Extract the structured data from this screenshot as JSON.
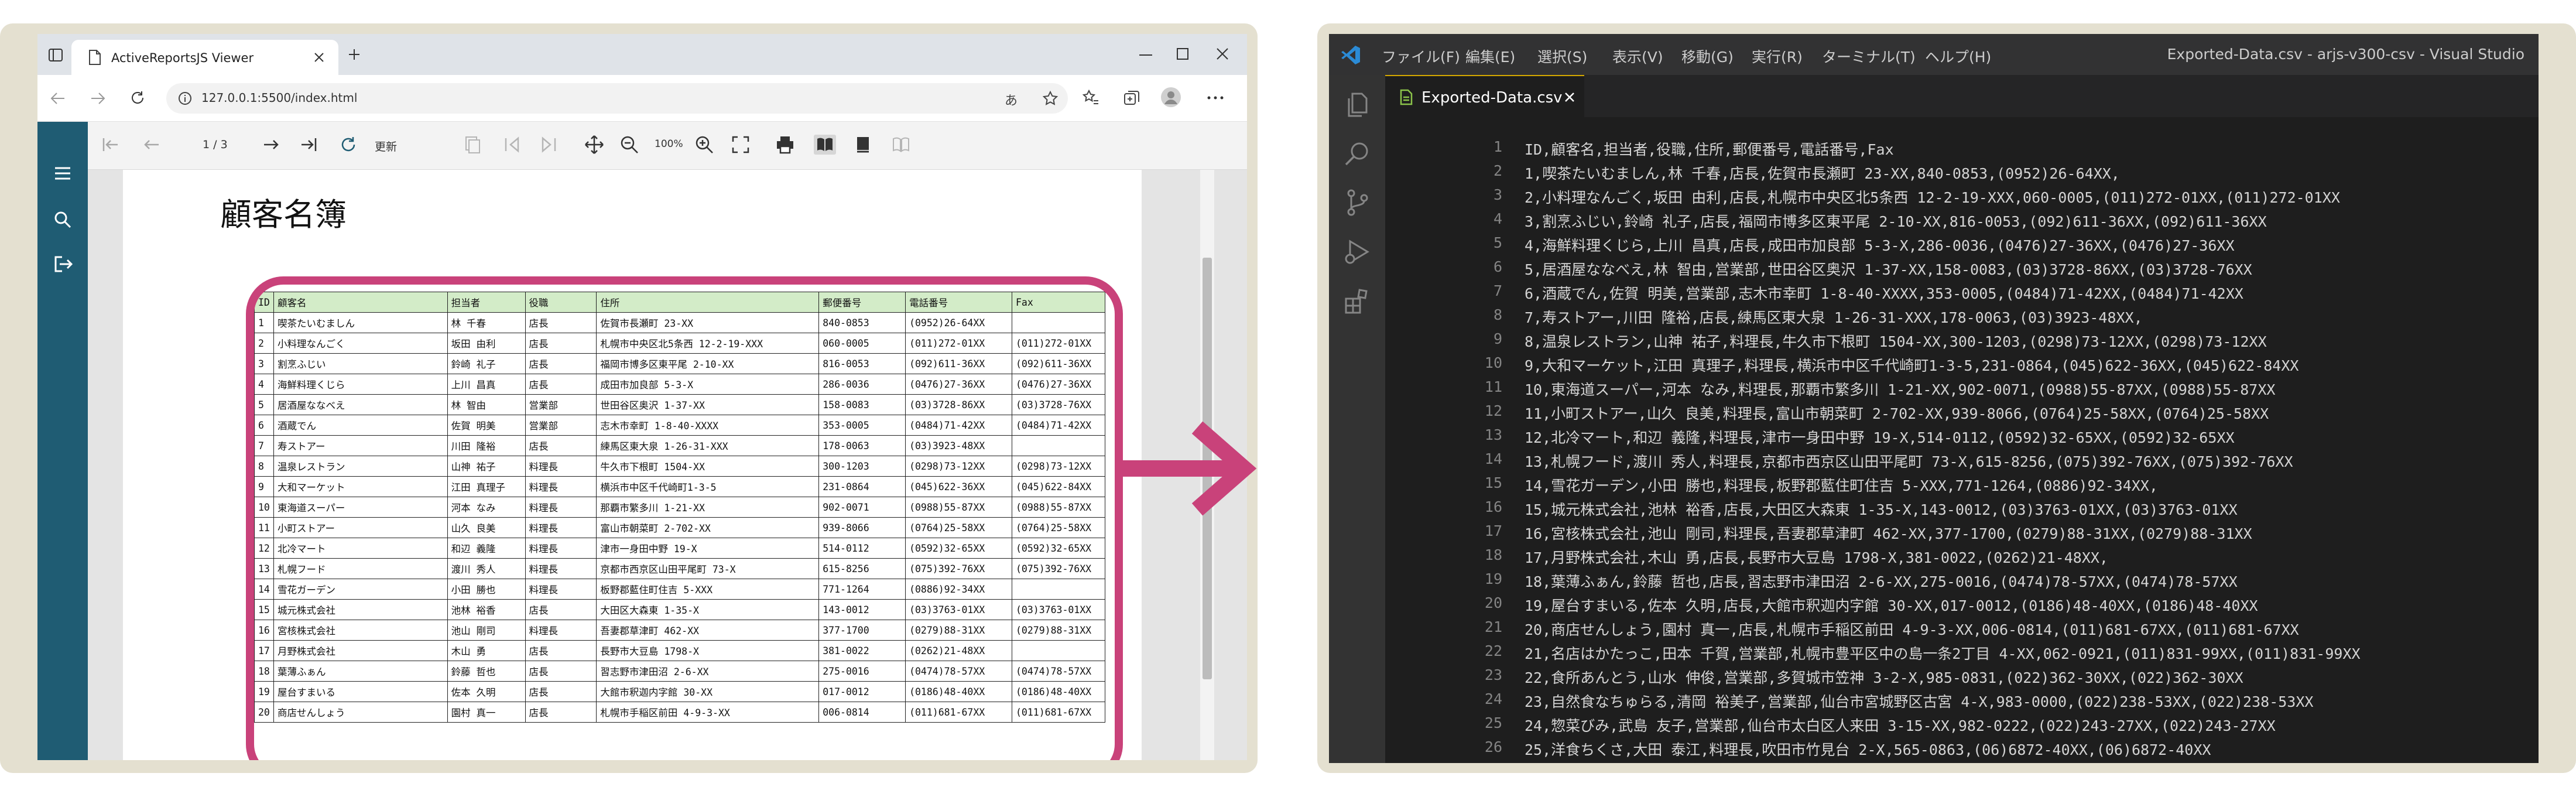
{
  "colors": {
    "highlight": "#c9427a",
    "arrow": "#c9427a",
    "app_sidebar": "#1f5c73",
    "table_header": "#d3ecc8",
    "panel": "#e4e0d0"
  },
  "browser": {
    "tab_title": "ActiveReportsJS Viewer",
    "url": "127.0.0.1:5500/index.html",
    "icons": [
      "back-icon",
      "forward-icon",
      "refresh-icon",
      "info-icon",
      "read-aloud-icon",
      "favorites-star-icon",
      "favorites-icon",
      "collections-icon",
      "profile-icon",
      "more-icon",
      "minimize-icon",
      "maximize-icon",
      "close-icon",
      "new-tab-icon"
    ]
  },
  "viewer": {
    "page_indicator": "1 / 3",
    "refresh_label": "更新",
    "zoom_label": "100%",
    "sidebar_icons": [
      "menu-icon",
      "search-icon",
      "export-icon"
    ],
    "document_title": "顧客名簿",
    "columns": [
      "ID",
      "顧客名",
      "担当者",
      "役職",
      "住所",
      "郵便番号",
      "電話番号",
      "Fax"
    ],
    "rows": [
      [
        "1",
        "喫茶たいむましん",
        "林 千春",
        "店長",
        "佐賀市長瀬町 23-XX",
        "840-0853",
        "(0952)26-64XX",
        ""
      ],
      [
        "2",
        "小料理なんごく",
        "坂田 由利",
        "店長",
        "札幌市中央区北5条西 12-2-19-XXX",
        "060-0005",
        "(011)272-01XX",
        "(011)272-01XX"
      ],
      [
        "3",
        "割烹ふじい",
        "鈴崎 礼子",
        "店長",
        "福岡市博多区東平尾 2-10-XX",
        "816-0053",
        "(092)611-36XX",
        "(092)611-36XX"
      ],
      [
        "4",
        "海鮮料理くじら",
        "上川 昌真",
        "店長",
        "成田市加良部 5-3-X",
        "286-0036",
        "(0476)27-36XX",
        "(0476)27-36XX"
      ],
      [
        "5",
        "居酒屋ななべえ",
        "林  智由",
        "営業部",
        "世田谷区奥沢 1-37-XX",
        "158-0083",
        "(03)3728-86XX",
        "(03)3728-76XX"
      ],
      [
        "6",
        "酒蔵でん",
        "佐賀 明美",
        "営業部",
        "志木市幸町 1-8-40-XXXX",
        "353-0005",
        "(0484)71-42XX",
        "(0484)71-42XX"
      ],
      [
        "7",
        "寿ストアー",
        "川田 隆裕",
        "店長",
        "練馬区東大泉 1-26-31-XXX",
        "178-0063",
        "(03)3923-48XX",
        ""
      ],
      [
        "8",
        "温泉レストラン",
        "山神 祐子",
        "料理長",
        "牛久市下根町 1504-XX",
        "300-1203",
        "(0298)73-12XX",
        "(0298)73-12XX"
      ],
      [
        "9",
        "大和マーケット",
        "江田 真理子",
        "料理長",
        "横浜市中区千代崎町1-3-5",
        "231-0864",
        "(045)622-36XX",
        "(045)622-84XX"
      ],
      [
        "10",
        "東海道スーパー",
        "河本 なみ",
        "料理長",
        "那覇市繁多川 1-21-XX",
        "902-0071",
        "(0988)55-87XX",
        "(0988)55-87XX"
      ],
      [
        "11",
        "小町ストアー",
        "山久 良美",
        "料理長",
        "富山市朝菜町 2-702-XX",
        "939-8066",
        "(0764)25-58XX",
        "(0764)25-58XX"
      ],
      [
        "12",
        "北冷マート",
        "和辺 義隆",
        "料理長",
        "津市一身田中野 19-X",
        "514-0112",
        "(0592)32-65XX",
        "(0592)32-65XX"
      ],
      [
        "13",
        "札幌フード",
        "渡川 秀人",
        "料理長",
        "京都市西京区山田平尾町 73-X",
        "615-8256",
        "(075)392-76XX",
        "(075)392-76XX"
      ],
      [
        "14",
        "雪花ガーデン",
        "小田 勝也",
        "料理長",
        "板野郡藍住町住吉 5-XXX",
        "771-1264",
        "(0886)92-34XX",
        ""
      ],
      [
        "15",
        "城元株式会社",
        "池林 裕香",
        "店長",
        "大田区大森東 1-35-X",
        "143-0012",
        "(03)3763-01XX",
        "(03)3763-01XX"
      ],
      [
        "16",
        "宮核株式会社",
        "池山 剛司",
        "料理長",
        "吾妻郡草津町 462-XX",
        "377-1700",
        "(0279)88-31XX",
        "(0279)88-31XX"
      ],
      [
        "17",
        "月野株式会社",
        "木山 勇",
        "店長",
        "長野市大豆島 1798-X",
        "381-0022",
        "(0262)21-48XX",
        ""
      ],
      [
        "18",
        "葉薄ふぁん",
        "鈴藤 哲也",
        "店長",
        "習志野市津田沼 2-6-XX",
        "275-0016",
        "(0474)78-57XX",
        "(0474)78-57XX"
      ],
      [
        "19",
        "屋台すまいる",
        "佐本 久明",
        "店長",
        "大館市釈迦内字館 30-XX",
        "017-0012",
        "(0186)48-40XX",
        "(0186)48-40XX"
      ],
      [
        "20",
        "商店せんしょう",
        "園村 真一",
        "店長",
        "札幌市手稲区前田 4-9-3-XX",
        "006-0814",
        "(011)681-67XX",
        "(011)681-67XX"
      ]
    ]
  },
  "vscode": {
    "window_title": "Exported-Data.csv - arjs-v300-csv - Visual Studio",
    "menu": [
      "ファイル(F)",
      "編集(E)",
      "選択(S)",
      "表示(V)",
      "移動(G)",
      "実行(R)",
      "ターミナル(T)",
      "ヘルプ(H)"
    ],
    "tab_name": "Exported-Data.csv",
    "activity_icons": [
      "explorer-icon",
      "search-icon",
      "source-control-icon",
      "run-debug-icon",
      "extensions-icon"
    ],
    "line_numbers": [
      "1",
      "2",
      "3",
      "4",
      "5",
      "6",
      "7",
      "8",
      "9",
      "10",
      "11",
      "12",
      "13",
      "14",
      "15",
      "16",
      "17",
      "18",
      "19",
      "20",
      "21",
      "22",
      "23",
      "24",
      "25",
      "26"
    ],
    "lines": [
      "ID,顧客名,担当者,役職,住所,郵便番号,電話番号,Fax",
      "1,喫茶たいむましん,林 千春,店長,佐賀市長瀬町 23-XX,840-0853,(0952)26-64XX,",
      "2,小料理なんごく,坂田 由利,店長,札幌市中央区北5条西 12-2-19-XXX,060-0005,(011)272-01XX,(011)272-01XX",
      "3,割烹ふじい,鈴崎 礼子,店長,福岡市博多区東平尾 2-10-XX,816-0053,(092)611-36XX,(092)611-36XX",
      "4,海鮮料理くじら,上川 昌真,店長,成田市加良部 5-3-X,286-0036,(0476)27-36XX,(0476)27-36XX",
      "5,居酒屋ななべえ,林 智由,営業部,世田谷区奥沢 1-37-XX,158-0083,(03)3728-86XX,(03)3728-76XX",
      "6,酒蔵でん,佐賀 明美,営業部,志木市幸町 1-8-40-XXXX,353-0005,(0484)71-42XX,(0484)71-42XX",
      "7,寿ストアー,川田 隆裕,店長,練馬区東大泉 1-26-31-XXX,178-0063,(03)3923-48XX,",
      "8,温泉レストラン,山神 祐子,料理長,牛久市下根町 1504-XX,300-1203,(0298)73-12XX,(0298)73-12XX",
      "9,大和マーケット,江田 真理子,料理長,横浜市中区千代崎町1-3-5,231-0864,(045)622-36XX,(045)622-84XX",
      "10,東海道スーパー,河本 なみ,料理長,那覇市繁多川 1-21-XX,902-0071,(0988)55-87XX,(0988)55-87XX",
      "11,小町ストアー,山久 良美,料理長,富山市朝菜町 2-702-XX,939-8066,(0764)25-58XX,(0764)25-58XX",
      "12,北冷マート,和辺 義隆,料理長,津市一身田中野 19-X,514-0112,(0592)32-65XX,(0592)32-65XX",
      "13,札幌フード,渡川 秀人,料理長,京都市西京区山田平尾町 73-X,615-8256,(075)392-76XX,(075)392-76XX",
      "14,雪花ガーデン,小田 勝也,料理長,板野郡藍住町住吉 5-XXX,771-1264,(0886)92-34XX,",
      "15,城元株式会社,池林 裕香,店長,大田区大森東 1-35-X,143-0012,(03)3763-01XX,(03)3763-01XX",
      "16,宮核株式会社,池山 剛司,料理長,吾妻郡草津町 462-XX,377-1700,(0279)88-31XX,(0279)88-31XX",
      "17,月野株式会社,木山 勇,店長,長野市大豆島 1798-X,381-0022,(0262)21-48XX,",
      "18,葉薄ふぁん,鈴藤 哲也,店長,習志野市津田沼 2-6-XX,275-0016,(0474)78-57XX,(0474)78-57XX",
      "19,屋台すまいる,佐本 久明,店長,大館市釈迦内字館 30-XX,017-0012,(0186)48-40XX,(0186)48-40XX",
      "20,商店せんしょう,園村 真一,店長,札幌市手稲区前田 4-9-3-XX,006-0814,(011)681-67XX,(011)681-67XX",
      "21,名店はかたっこ,田本 千賀,営業部,札幌市豊平区中の島一条2丁目 4-XX,062-0921,(011)831-99XX,(011)831-99XX",
      "22,食所あんとう,山水 伸俊,営業部,多賀城市笠神 3-2-X,985-0831,(022)362-30XX,(022)362-30XX",
      "23,自然食なちゅらる,清岡 裕美子,営業部,仙台市宮城野区古宮 4-X,983-0000,(022)238-53XX,(022)238-53XX",
      "24,惣菜びみ,武島 友子,営業部,仙台市太白区人来田 3-15-XX,982-0222,(022)243-27XX,(022)243-27XX",
      "25,洋食ちくさ,大田 泰江,料理長,吹田市竹見台 2-X,565-0863,(06)6872-40XX,(06)6872-40XX"
    ]
  }
}
